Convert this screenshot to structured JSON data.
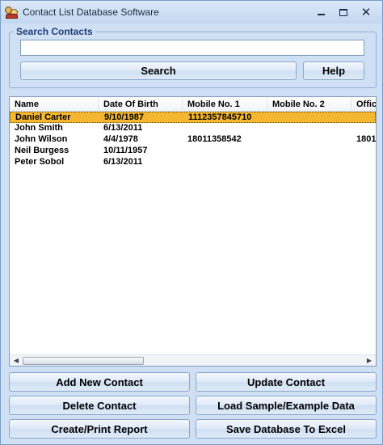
{
  "window": {
    "title": "Contact List Database Software",
    "controls": {
      "minimize": "minimize",
      "maximize": "maximize",
      "close": "✕"
    }
  },
  "search": {
    "group_label": "Search Contacts",
    "input_value": "",
    "search_label": "Search",
    "help_label": "Help"
  },
  "table": {
    "columns": [
      "Name",
      "Date Of Birth",
      "Mobile No. 1",
      "Mobile No. 2",
      "Offic"
    ],
    "rows": [
      [
        "Daniel Carter",
        "9/10/1987",
        "1112357845710",
        "",
        ""
      ],
      [
        "John Smith",
        "6/13/2011",
        "",
        "",
        ""
      ],
      [
        "John Wilson",
        "4/4/1978",
        "18011358542",
        "",
        "1801"
      ],
      [
        "Neil Burgess",
        "10/11/1957",
        "",
        "",
        ""
      ],
      [
        "Peter Sobol",
        "6/13/2011",
        "",
        "",
        ""
      ]
    ],
    "selected_row": 0
  },
  "actions": {
    "add": "Add New Contact",
    "update": "Update Contact",
    "delete": "Delete Contact",
    "load": "Load Sample/Example Data",
    "report": "Create/Print Report",
    "save": "Save Database To Excel"
  },
  "colors": {
    "background": "#cfe0f5",
    "selection": "#f5b731",
    "group_label": "#1e3c78"
  }
}
